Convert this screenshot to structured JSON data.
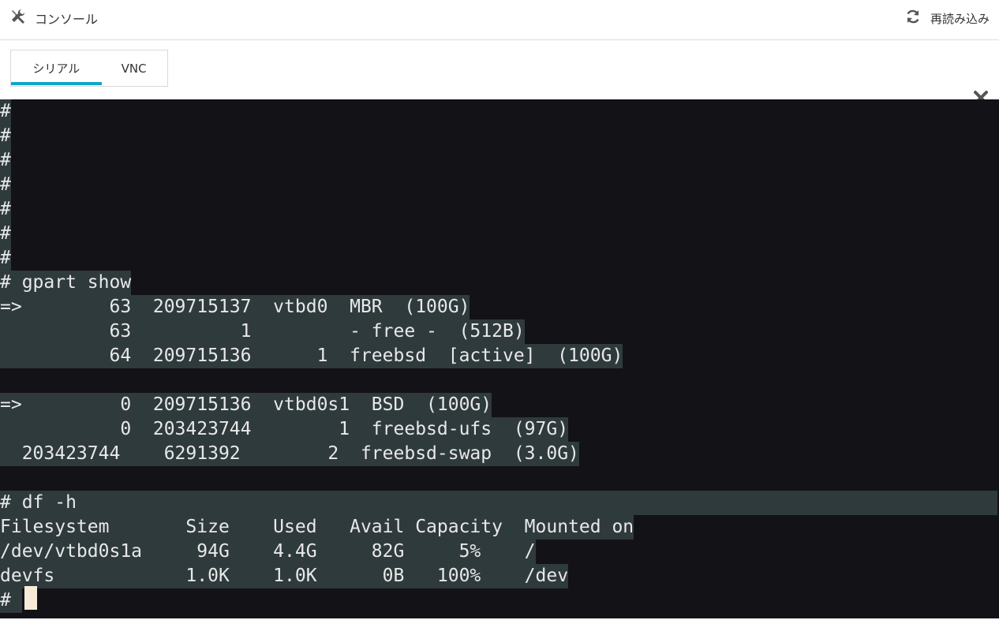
{
  "header": {
    "title": "コンソール",
    "title_icon": "tools-icon",
    "reload_label": "再読み込み",
    "reload_icon": "refresh-icon"
  },
  "tabs": [
    {
      "label": "シリアル",
      "active": true
    },
    {
      "label": "VNC",
      "active": false
    }
  ],
  "colors": {
    "accent": "#0fa7c6",
    "terminal_bg": "#121217",
    "selection_bg": "#2f3a3d",
    "cursor": "#f6ebd9"
  },
  "terminal": {
    "lines": [
      "#",
      "#",
      "#",
      "#",
      "#",
      "#",
      "#",
      "# gpart show",
      "=>        63  209715137  vtbd0  MBR  (100G)",
      "          63          1         - free -  (512B)",
      "          64  209715136      1  freebsd  [active]  (100G)",
      "",
      "=>         0  209715136  vtbd0s1  BSD  (100G)",
      "           0  203423744        1  freebsd-ufs  (97G)",
      "  203423744    6291392        2  freebsd-swap  (3.0G)",
      "",
      "# df -h",
      "Filesystem       Size    Used   Avail Capacity  Mounted on",
      "/dev/vtbd0s1a     94G    4.4G     82G     5%    /",
      "devfs            1.0K    1.0K      0B   100%    /dev",
      "# "
    ]
  }
}
